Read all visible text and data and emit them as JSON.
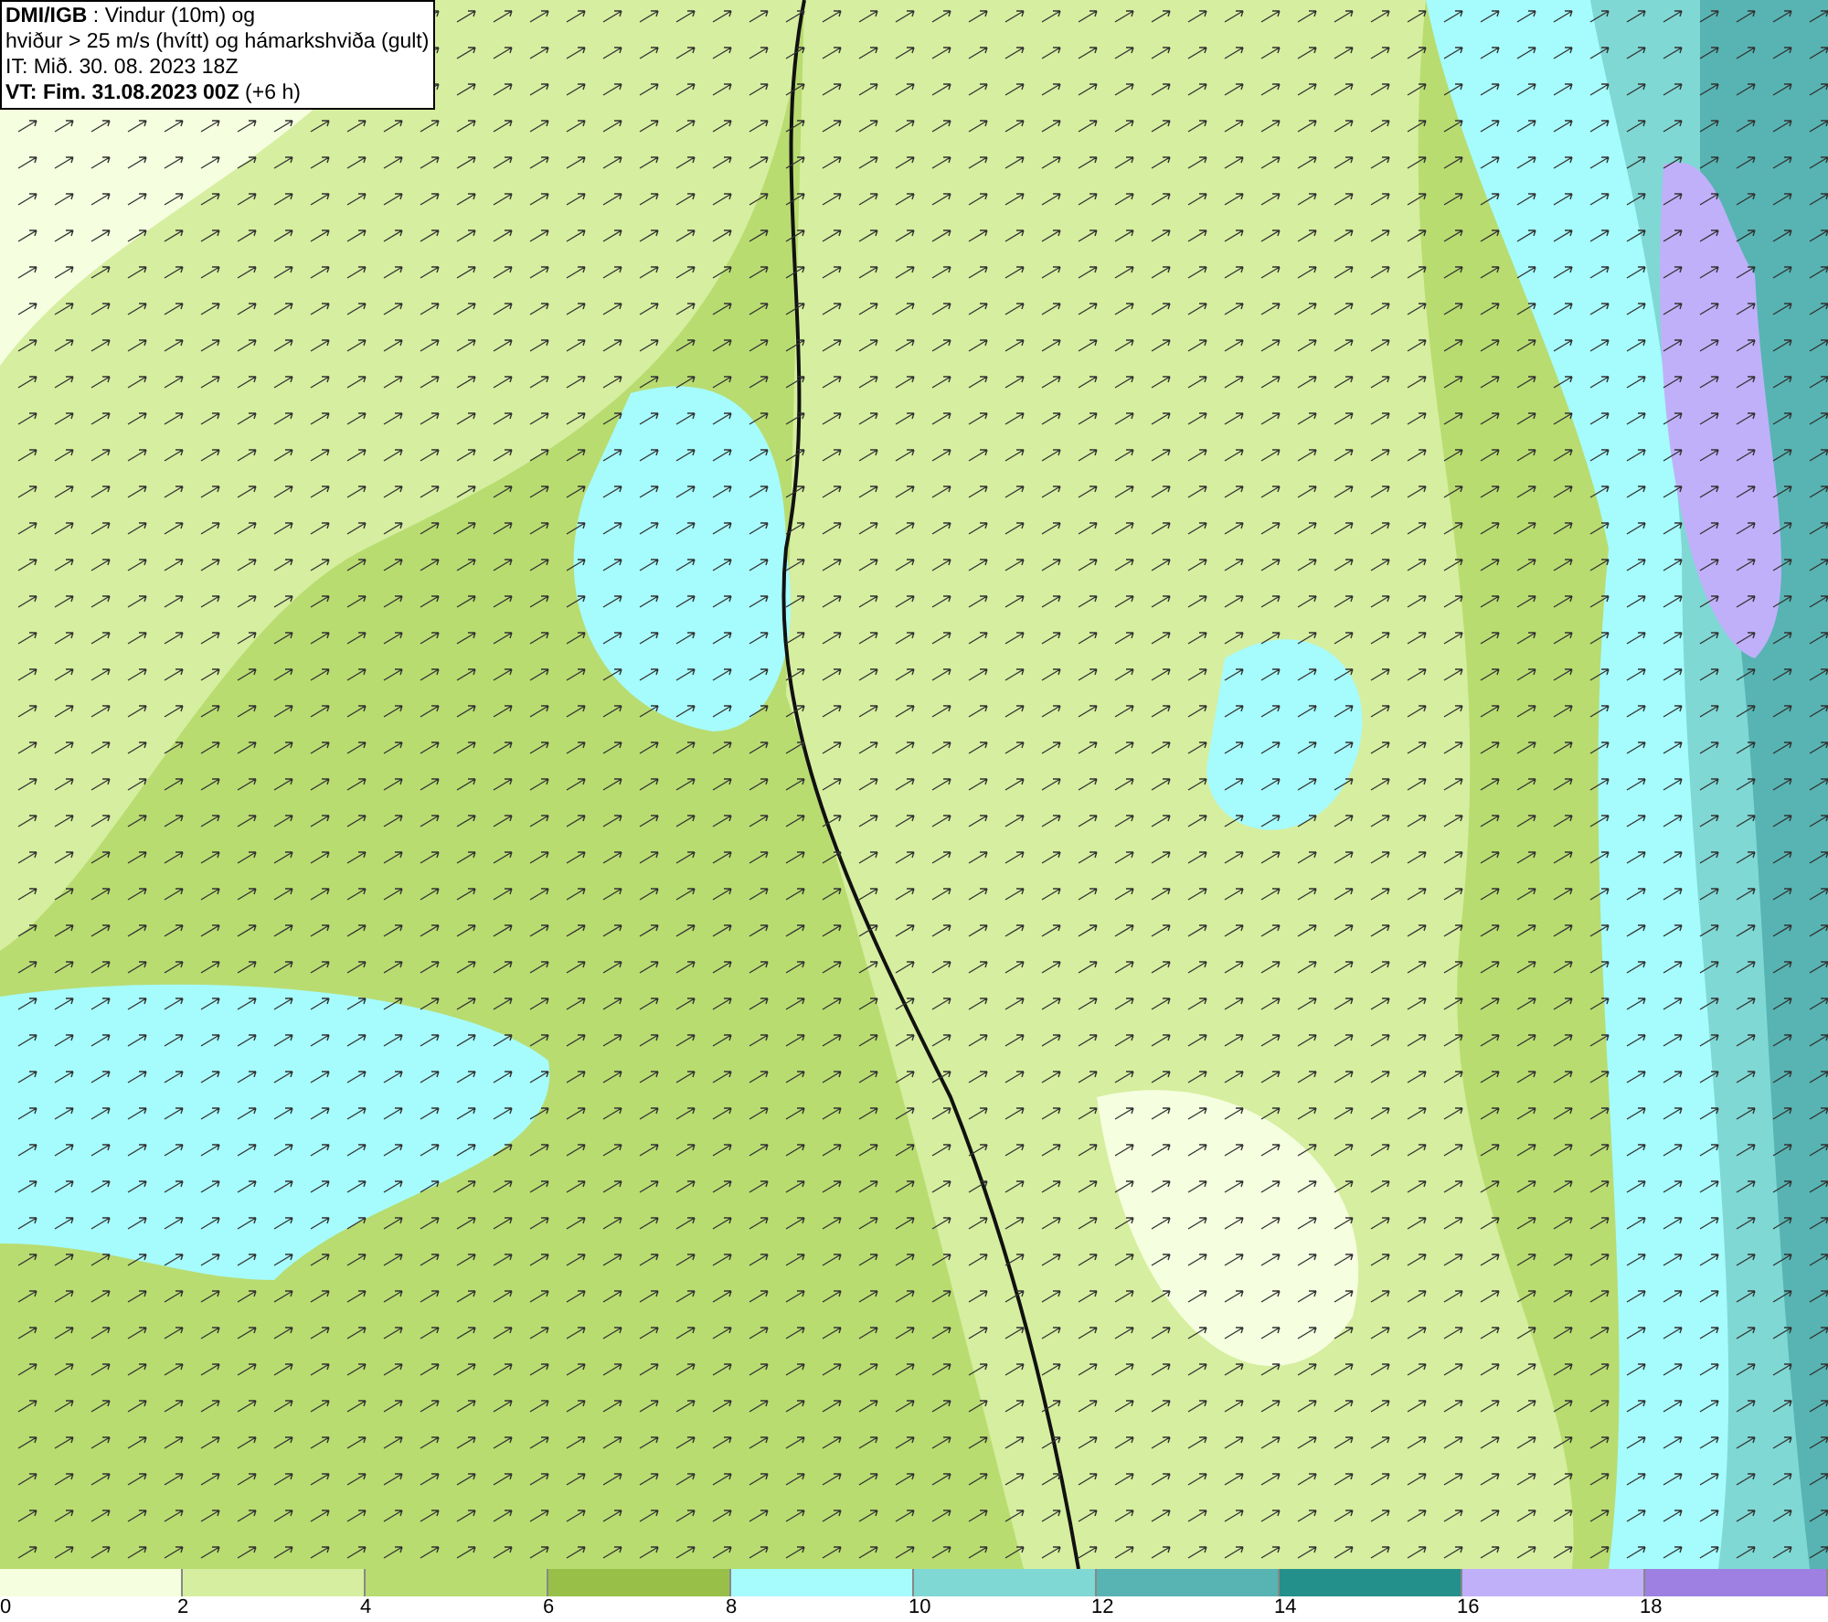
{
  "header": {
    "lines": [
      "**DMI/IGB** : Vindur (10m) og",
      "hviður > 25 m/s (hvítt) og hámarkshviða (gult)",
      "IT: Mið. 30. 08. 2023 18Z",
      "**VT: Fim. 31.08.2023 00Z** (+6 h)"
    ]
  },
  "legend": [
    {
      "label": "0",
      "color": "#f5fedf"
    },
    {
      "label": "2",
      "color": "#d6ee9f"
    },
    {
      "label": "4",
      "color": "#b8dc70"
    },
    {
      "label": "6",
      "color": "#98c048"
    },
    {
      "label": "8",
      "color": "#a6fbfc"
    },
    {
      "label": "10",
      "color": "#7fd8d4"
    },
    {
      "label": "12",
      "color": "#57b4b3"
    },
    {
      "label": "14",
      "color": "#23908b"
    },
    {
      "label": "16",
      "color": "#c0b0fa"
    },
    {
      "label": "18",
      "color": "#9d80e2"
    }
  ]
}
